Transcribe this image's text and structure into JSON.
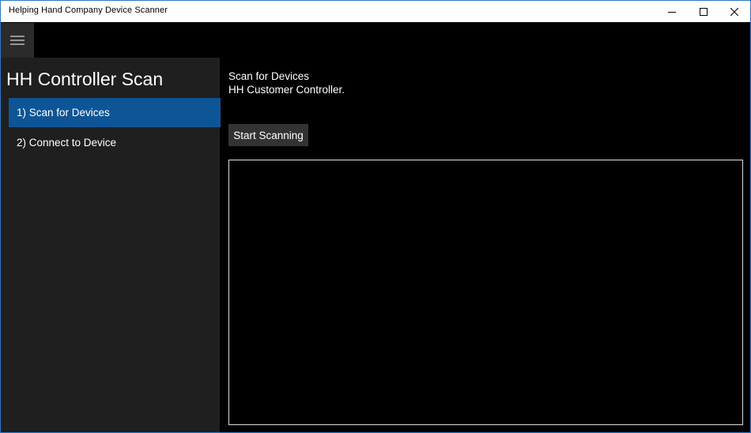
{
  "window": {
    "title": "Helping Hand Company Device Scanner",
    "accent_border": "#2b78c5"
  },
  "caption_buttons": [
    "minimize-icon",
    "maximize-icon",
    "close-icon"
  ],
  "hamburger": {
    "icon": "hamburger-menu-icon"
  },
  "sidebar": {
    "heading": "HH Controller Scan",
    "items": [
      {
        "label": "1) Scan for Devices",
        "selected": true
      },
      {
        "label": "2) Connect to Device",
        "selected": false
      }
    ],
    "selected_color": "#0e5597"
  },
  "main": {
    "title": "Scan for Devices",
    "subtitle": "HH Customer Controller.",
    "start_button_label": "Start Scanning",
    "results": []
  }
}
